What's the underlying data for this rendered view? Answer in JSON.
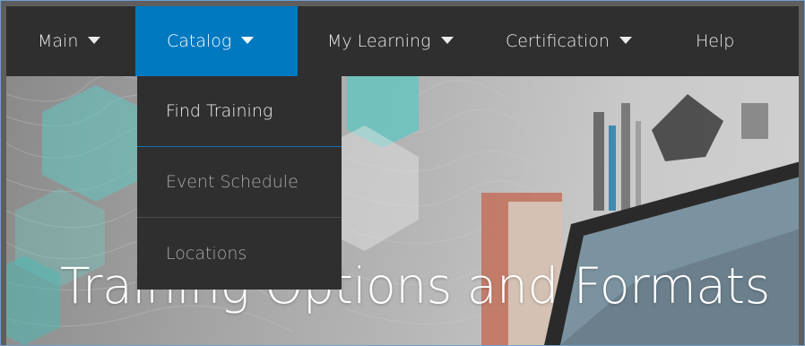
{
  "nav": {
    "items": [
      {
        "label": "Main",
        "has_dropdown": true,
        "active": false
      },
      {
        "label": "Catalog",
        "has_dropdown": true,
        "active": true
      },
      {
        "label": "My Learning",
        "has_dropdown": true,
        "active": false
      },
      {
        "label": "Certification",
        "has_dropdown": true,
        "active": false
      },
      {
        "label": "Help",
        "has_dropdown": false,
        "active": false
      }
    ],
    "active_color": "#0079c1",
    "bar_color": "#2f2f2f"
  },
  "catalog_menu": {
    "items": [
      {
        "label": "Find Training",
        "highlighted": true
      },
      {
        "label": "Event Schedule",
        "highlighted": false
      },
      {
        "label": "Locations",
        "highlighted": false
      }
    ]
  },
  "hero": {
    "title": "Training Options and Formats",
    "accent_color": "#5fc7c0"
  }
}
